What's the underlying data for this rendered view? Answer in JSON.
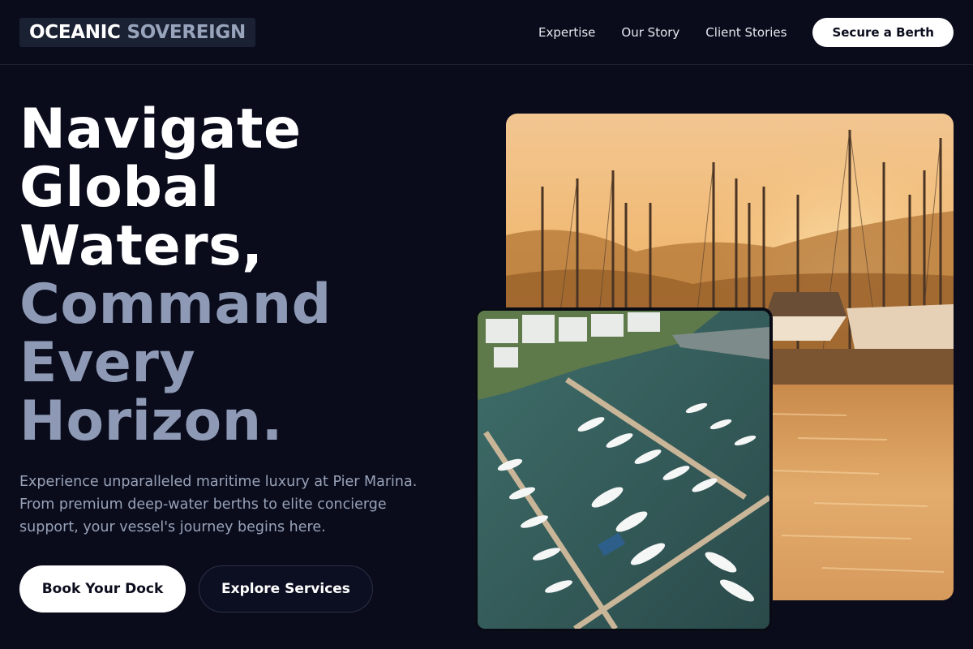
{
  "brand": {
    "word1": "OCEANIC",
    "word2": "SOVEREIGN"
  },
  "nav": {
    "links": [
      "Expertise",
      "Our Story",
      "Client Stories"
    ],
    "cta": "Secure a Berth"
  },
  "hero": {
    "headline_lines": [
      "Navigate",
      "Global",
      "Waters,"
    ],
    "headline_accent_lines": [
      "Command",
      "Every",
      "Horizon."
    ],
    "description": "Experience unparalleled maritime luxury at Pier Marina. From premium deep-water berths to elite concierge support, your vessel's journey begins here.",
    "primary_button": "Book Your Dock",
    "secondary_button": "Explore Services"
  },
  "images": {
    "sunset": "sunset-marina-sailboats-photo",
    "aerial": "aerial-marina-yachts-photo"
  },
  "colors": {
    "background": "#0a0c1c",
    "accent_text": "#8e9ab5",
    "button_light": "#ffffff"
  }
}
